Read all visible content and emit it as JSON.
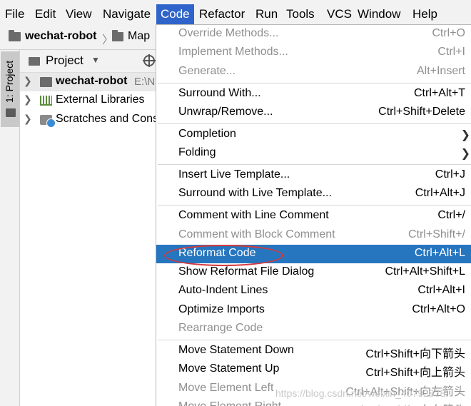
{
  "menubar": {
    "items": [
      "File",
      "Edit",
      "View",
      "Navigate",
      "Code",
      "Refactor",
      "Run",
      "Tools",
      "VCS",
      "Window",
      "Help"
    ],
    "active": "Code"
  },
  "navbar": {
    "project": "wechat-robot",
    "next": "Map"
  },
  "stripe": {
    "tab_label": "1: Project"
  },
  "panel": {
    "title": "Project",
    "rows": [
      {
        "label": "wechat-robot",
        "path": "E:\\N"
      },
      {
        "label": "External Libraries"
      },
      {
        "label": "Scratches and Cons"
      }
    ]
  },
  "menu": {
    "items": [
      {
        "label": "Override Methods...",
        "shortcut": "Ctrl+O",
        "disabled": true
      },
      {
        "label": "Implement Methods...",
        "shortcut": "Ctrl+I",
        "disabled": true
      },
      {
        "label": "Generate...",
        "shortcut": "Alt+Insert",
        "disabled": true
      },
      {
        "label": "Surround With...",
        "shortcut": "Ctrl+Alt+T"
      },
      {
        "label": "Unwrap/Remove...",
        "shortcut": "Ctrl+Shift+Delete"
      },
      {
        "label": "Completion",
        "shortcut": ""
      },
      {
        "label": "Folding",
        "shortcut": ""
      },
      {
        "label": "Insert Live Template...",
        "shortcut": "Ctrl+J"
      },
      {
        "label": "Surround with Live Template...",
        "shortcut": "Ctrl+Alt+J"
      },
      {
        "label": "Comment with Line Comment",
        "shortcut": "Ctrl+/"
      },
      {
        "label": "Comment with Block Comment",
        "shortcut": "Ctrl+Shift+/",
        "disabled": true
      },
      {
        "label": "Reformat Code",
        "shortcut": "Ctrl+Alt+L",
        "highlighted": true
      },
      {
        "label": "Show Reformat File Dialog",
        "shortcut": "Ctrl+Alt+Shift+L"
      },
      {
        "label": "Auto-Indent Lines",
        "shortcut": "Ctrl+Alt+I"
      },
      {
        "label": "Optimize Imports",
        "shortcut": "Ctrl+Alt+O"
      },
      {
        "label": "Rearrange Code",
        "shortcut": "",
        "disabled": true
      },
      {
        "label": "Move Statement Down",
        "shortcut": "Ctrl+Shift+向下箭头"
      },
      {
        "label": "Move Statement Up",
        "shortcut": "Ctrl+Shift+向上箭头"
      },
      {
        "label": "Move Element Left",
        "shortcut": "Ctrl+Alt+Shift+向左箭头",
        "disabled": true
      },
      {
        "label": "Move Element Right",
        "shortcut": "Ctrl+Alt+Shift+向右箭头",
        "disabled": true
      }
    ]
  },
  "watermark": "https://blog.csdn.net/weixin_40792878",
  "colors": {
    "highlight": "#2675bf",
    "active_menu": "#2f65ca",
    "annotation_ring": "#d83a3a"
  }
}
